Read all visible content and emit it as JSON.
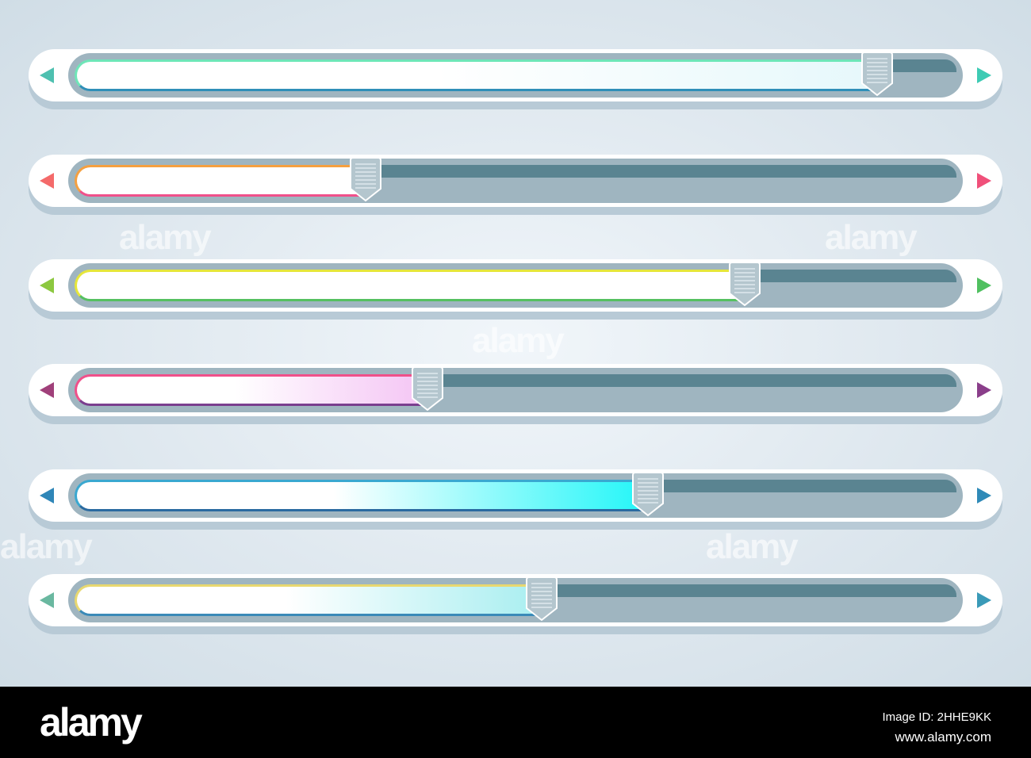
{
  "sliders": [
    {
      "value": 0.91,
      "accent_start": "#6fe6b8",
      "accent_end": "#2f8fb8",
      "fill_end": "#e6f8fb",
      "arrow_left": "#4ec0b0",
      "arrow_right": "#3ecbb4"
    },
    {
      "value": 0.33,
      "accent_start": "#f5a040",
      "accent_end": "#f0508a",
      "fill_end": "#ffffff",
      "arrow_left": "#f46a6a",
      "arrow_right": "#f0507a"
    },
    {
      "value": 0.76,
      "accent_start": "#e6e63a",
      "accent_end": "#55c060",
      "fill_end": "#ffffff",
      "arrow_left": "#8cc840",
      "arrow_right": "#50c060"
    },
    {
      "value": 0.4,
      "accent_start": "#f0508a",
      "accent_end": "#7a3e8e",
      "fill_end": "#f4c4f4",
      "arrow_left": "#a0407a",
      "arrow_right": "#8a3e8a"
    },
    {
      "value": 0.65,
      "accent_start": "#3aa8d0",
      "accent_end": "#2a6aa0",
      "fill_end": "#22f6f8",
      "arrow_left": "#2f86b8",
      "arrow_right": "#2f8ab8"
    },
    {
      "value": 0.53,
      "accent_start": "#e8d870",
      "accent_end": "#3a8ab8",
      "fill_end": "#a8eef0",
      "arrow_left": "#6ab8a0",
      "arrow_right": "#3a9ab8"
    }
  ],
  "watermark": "alamy",
  "footer": {
    "logo": "alamy",
    "image_id": "Image ID: 2HHE9KK",
    "site": "www.alamy.com"
  }
}
